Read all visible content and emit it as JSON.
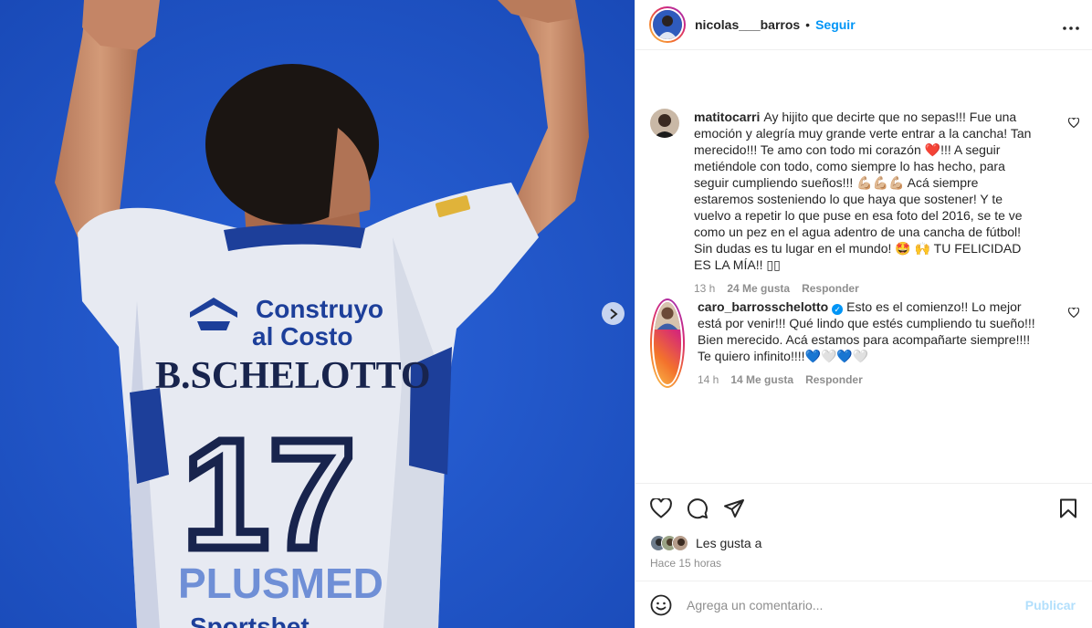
{
  "post": {
    "author": "nicolas___barros",
    "follow_label": "Seguir",
    "separator": "•",
    "more_label": "•••"
  },
  "photo": {
    "sponsor_line1": "Construyo",
    "sponsor_line2": "al Costo",
    "player_name": "B.SCHELOTTO",
    "number": "17",
    "bottom_sponsor": "PLUSMED",
    "bottom_sponsor2": "Sportsbet"
  },
  "comments": [
    {
      "user": "matitocarri",
      "verified": false,
      "text": "Ay hijito que decirte que no sepas!!! Fue una emoción y alegría muy grande verte entrar a la cancha! Tan merecido!!! Te amo con todo mi corazón ❤️!!! A seguir metiéndole con todo, como siempre lo has hecho, para seguir cumpliendo sueños!!! 💪🏼💪🏼💪🏼 Acá siempre estaremos sosteniendo lo que haya que sostener! Y te vuelvo a repetir lo que puse en esa foto del 2016, se te ve como un pez en el agua adentro de una cancha de fútbol! Sin dudas es tu lugar en el mundo! 🤩 🙌 TU FELICIDAD ES LA MÍA!! ▯▯",
      "time": "13 h",
      "likes": "24 Me gusta",
      "reply": "Responder"
    },
    {
      "user": "caro_barrosschelotto",
      "verified": true,
      "text": "Esto es el comienzo!! Lo mejor está por venir!!! Qué lindo que estés cumpliendo tu sueño!!! Bien merecido. Acá estamos para acompañarte siempre!!!! Te quiero infinito!!!!💙🤍💙🤍",
      "time": "14 h",
      "likes": "14 Me gusta",
      "reply": "Responder"
    }
  ],
  "footer": {
    "likes_text": "Les gusta a",
    "time_ago": "Hace 15 horas",
    "comment_placeholder": "Agrega un comentario...",
    "post_label": "Publicar"
  },
  "icons": [
    "heart-icon",
    "comment-icon",
    "share-icon",
    "bookmark-icon",
    "emoji-icon",
    "chevron-right-icon",
    "more-icon"
  ],
  "colors": {
    "accent": "#0095f6",
    "photo_bg": "#1f56c8",
    "jersey_stripe": "#1d3f9a"
  }
}
